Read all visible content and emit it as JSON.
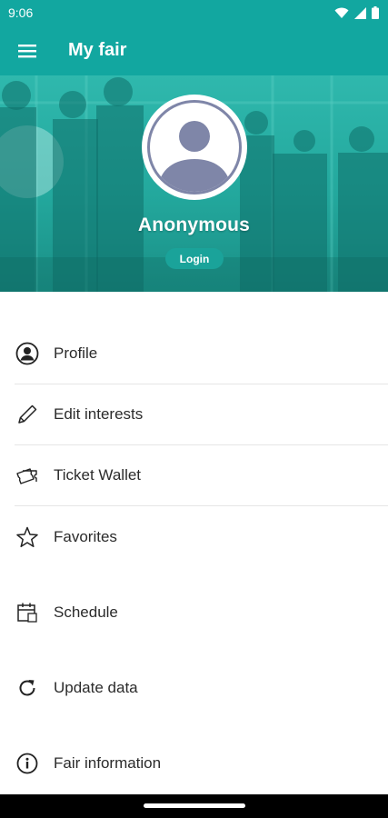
{
  "status_bar": {
    "time": "9:06",
    "wifi_icon": "wifi-icon",
    "signal_icon": "signal-icon",
    "battery_icon": "battery-icon"
  },
  "app_bar": {
    "menu_icon": "hamburger-menu-icon",
    "title": "My fair"
  },
  "profile_header": {
    "name": "Anonymous",
    "login_label": "Login",
    "avatar_icon": "user-avatar-icon"
  },
  "menu": {
    "items": [
      {
        "label": "Profile",
        "icon": "profile-icon"
      },
      {
        "label": "Edit interests",
        "icon": "pencil-icon"
      },
      {
        "label": "Ticket Wallet",
        "icon": "tickets-icon"
      },
      {
        "label": "Favorites",
        "icon": "star-icon"
      },
      {
        "label": "Schedule",
        "icon": "calendar-icon"
      },
      {
        "label": "Update data",
        "icon": "refresh-icon"
      },
      {
        "label": "Fair information",
        "icon": "info-icon"
      }
    ]
  },
  "colors": {
    "primary": "#12a7a0",
    "header_teal": "#23a89d",
    "avatar_gray": "#7f86a8",
    "text": "#2b2b2b"
  }
}
